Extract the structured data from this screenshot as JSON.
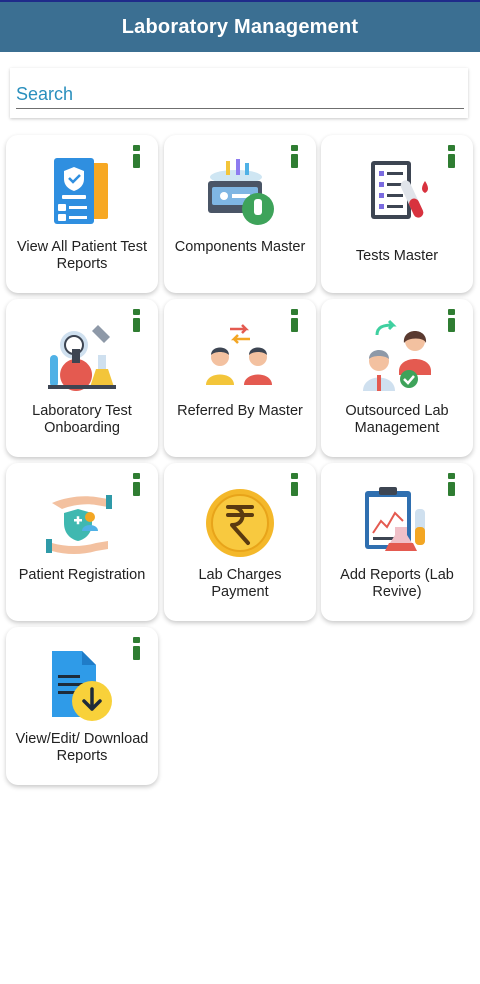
{
  "header": {
    "title": "Laboratory Management"
  },
  "search": {
    "placeholder": "Search"
  },
  "tiles": [
    {
      "label": "View All Patient Test Reports",
      "icon": "patient-reports-icon"
    },
    {
      "label": "Components Master",
      "icon": "components-icon"
    },
    {
      "label": "Tests Master",
      "icon": "tests-master-icon"
    },
    {
      "label": "Laboratory Test Onboarding",
      "icon": "lab-onboarding-icon"
    },
    {
      "label": "Referred By Master",
      "icon": "referred-by-icon"
    },
    {
      "label": "Outsourced Lab Management",
      "icon": "outsourced-lab-icon"
    },
    {
      "label": "Patient Registration",
      "icon": "patient-registration-icon"
    },
    {
      "label": "Lab Charges Payment",
      "icon": "rupee-coin-icon"
    },
    {
      "label": "Add Reports (Lab Revive)",
      "icon": "add-reports-icon"
    },
    {
      "label": "View/Edit/ Download Reports",
      "icon": "download-report-icon"
    }
  ],
  "colors": {
    "header_bg": "#3b6f92",
    "info_icon": "#2f7d32",
    "search_text": "#2a8fbd"
  }
}
